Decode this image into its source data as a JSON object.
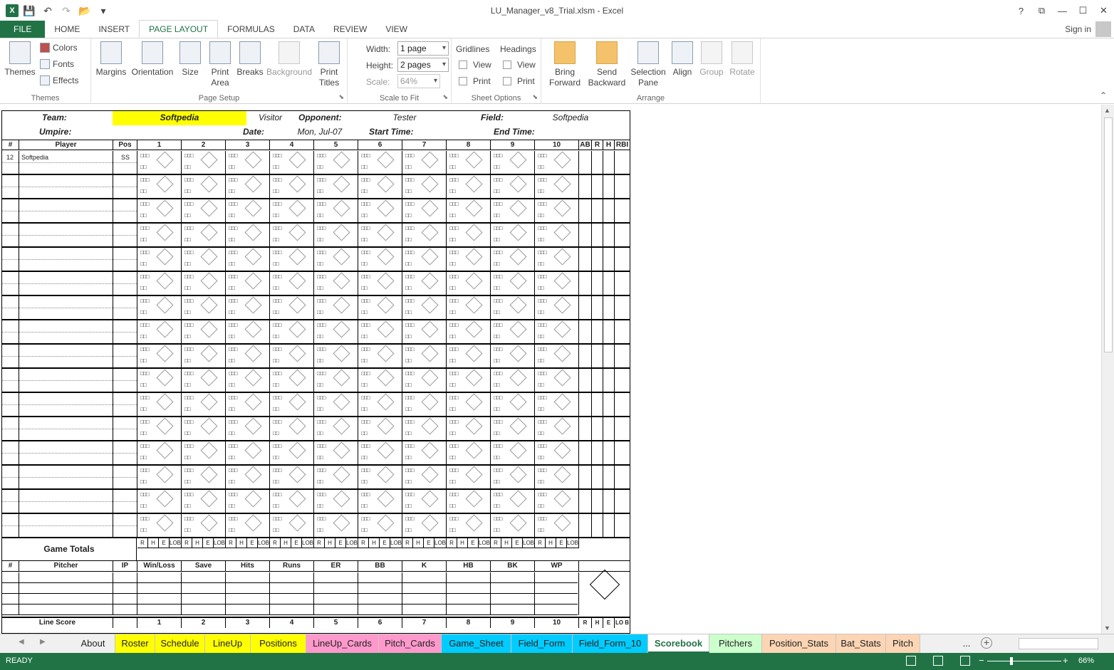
{
  "window": {
    "title": "LU_Manager_v8_Trial.xlsm - Excel",
    "help": "?",
    "ribbon_display": "⧉",
    "minimize": "—",
    "maximize": "☐",
    "close": "✕",
    "signin": "Sign in"
  },
  "qat": {
    "logo": "X",
    "save": "💾",
    "undo": "↶",
    "redo": "↷",
    "open": "📂",
    "customize": "▾"
  },
  "tabs": [
    "FILE",
    "HOME",
    "INSERT",
    "PAGE LAYOUT",
    "FORMULAS",
    "DATA",
    "REVIEW",
    "VIEW"
  ],
  "ribbon": {
    "themes_group": {
      "label": "Themes",
      "themes_btn": "Themes",
      "colors": "Colors",
      "fonts": "Fonts",
      "effects": "Effects"
    },
    "page_setup_group": {
      "label": "Page Setup",
      "margins": "Margins",
      "orientation": "Orientation",
      "size": "Size",
      "print_area": "Print Area",
      "breaks": "Breaks",
      "background": "Background",
      "print_titles": "Print Titles"
    },
    "scale_group": {
      "label": "Scale to Fit",
      "width_label": "Width:",
      "width_val": "1 page",
      "height_label": "Height:",
      "height_val": "2 pages",
      "scale_label": "Scale:",
      "scale_val": "64%"
    },
    "sheet_options": {
      "label": "Sheet Options",
      "gridlines": "Gridlines",
      "headings": "Headings",
      "view": "View",
      "print": "Print"
    },
    "arrange_group": {
      "label": "Arrange",
      "bring_forward": "Bring Forward",
      "send_backward": "Send Backward",
      "selection_pane": "Selection Pane",
      "align": "Align",
      "group": "Group",
      "rotate": "Rotate"
    }
  },
  "scorecard": {
    "team_label": "Team:",
    "team": "Softpedia",
    "visitor": "Visitor",
    "opponent_label": "Opponent:",
    "opponent": "Tester",
    "field_label": "Field:",
    "field": "Softpedia",
    "umpire_label": "Umpire:",
    "date_label": "Date:",
    "date": "Mon,  Jul-07",
    "start_label": "Start Time:",
    "end_label": "End Time:",
    "col_num": "#",
    "col_player": "Player",
    "col_pos": "Pos",
    "innings": [
      "1",
      "2",
      "3",
      "4",
      "5",
      "6",
      "7",
      "8",
      "9",
      "10"
    ],
    "stats": [
      "AB",
      "R",
      "H",
      "RBI"
    ],
    "player1": {
      "num": "12",
      "name": "Softpedia",
      "pos": "SS"
    },
    "cell_marks": [
      "□□□",
      "□□"
    ],
    "game_totals": "Game Totals",
    "rhel": [
      "R",
      "H",
      "E",
      "LOB"
    ],
    "pitch_cols": [
      "#",
      "Pitcher",
      "IP",
      "Win/Loss",
      "Save",
      "Hits",
      "Runs",
      "ER",
      "BB",
      "K",
      "HB",
      "BK",
      "WP"
    ],
    "line_score": "Line Score",
    "line_rhe": [
      "R",
      "H",
      "E",
      "LO B"
    ]
  },
  "sheet_tabs": [
    {
      "label": "About",
      "color": "#f0f0f0"
    },
    {
      "label": "Roster",
      "color": "#ffff00"
    },
    {
      "label": "Schedule",
      "color": "#ffff00"
    },
    {
      "label": "LineUp",
      "color": "#ffff00"
    },
    {
      "label": "Positions",
      "color": "#ffff00"
    },
    {
      "label": "LineUp_Cards",
      "color": "#ff99cc"
    },
    {
      "label": "Pitch_Cards",
      "color": "#ff99cc"
    },
    {
      "label": "Game_Sheet",
      "color": "#00ccff"
    },
    {
      "label": "Field_Form",
      "color": "#00ccff"
    },
    {
      "label": "Field_Form_10",
      "color": "#00ccff"
    },
    {
      "label": "Scorebook",
      "color": "#ffffff"
    },
    {
      "label": "Pitchers",
      "color": "#ccffcc"
    },
    {
      "label": "Position_Stats",
      "color": "#fcd5b4"
    },
    {
      "label": "Bat_Stats",
      "color": "#fcd5b4"
    },
    {
      "label": "Pitch",
      "color": "#fcd5b4"
    }
  ],
  "more_tabs": "...",
  "status": {
    "ready": "READY",
    "zoom": "66%",
    "minus": "−",
    "plus": "+"
  }
}
